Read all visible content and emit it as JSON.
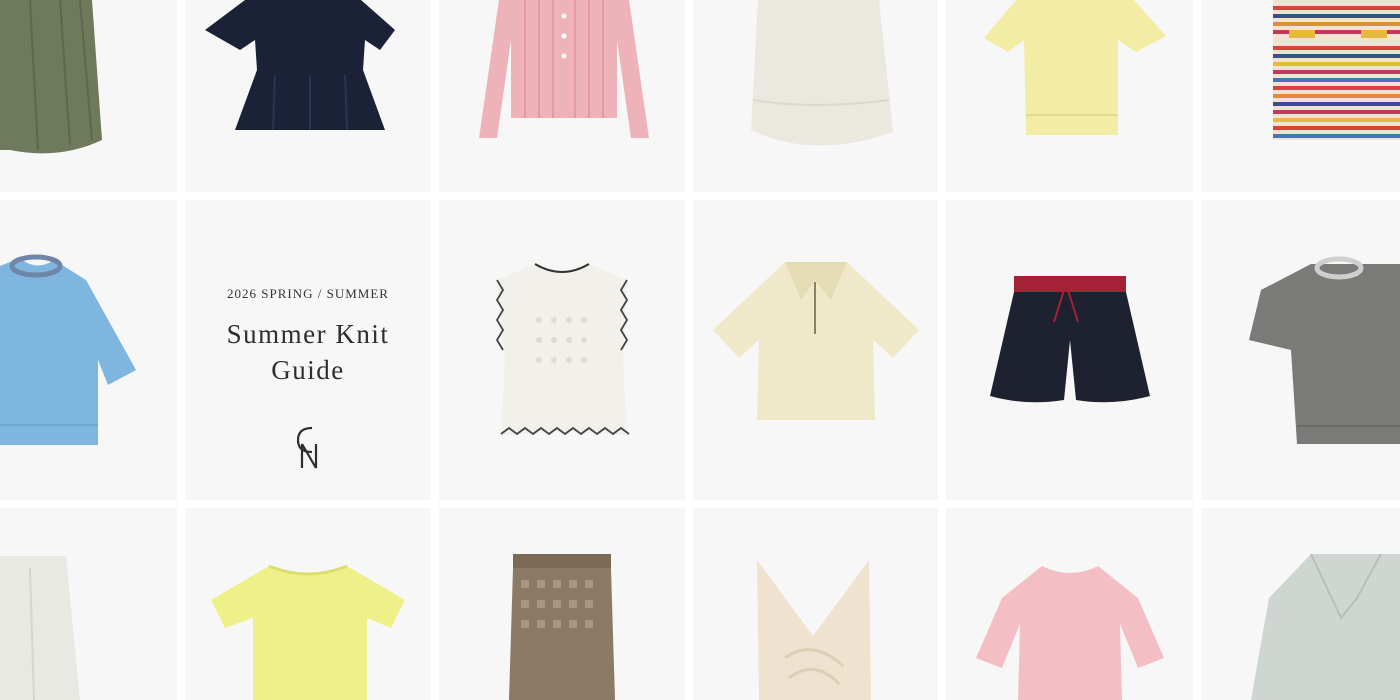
{
  "banner": {
    "season": "2026 SPRING / SUMMER",
    "title_line1": "Summer Knit",
    "title_line2": "Guide",
    "logo_text": "CN",
    "background": "#f7f7f8",
    "divider": "#ffffff"
  },
  "products": [
    {
      "id": "olive-skirt",
      "icon": "olive-knit-skirt",
      "color": "#6f7a5c"
    },
    {
      "id": "navy-peplum",
      "icon": "navy-peplum-top",
      "color": "#1b2238"
    },
    {
      "id": "pink-cardigan",
      "icon": "pink-rib-cardigan",
      "color": "#eeb3b9"
    },
    {
      "id": "ivory-top",
      "icon": "ivory-knit-top",
      "color": "#ebe8df"
    },
    {
      "id": "yellow-tee",
      "icon": "yellow-knit-tee",
      "color": "#f3eca4"
    },
    {
      "id": "stripe-knit",
      "icon": "multi-stripe-knit",
      "color": "#d9443a"
    },
    {
      "id": "blue-tee",
      "icon": "blue-sheer-knit",
      "color": "#7fb6e0"
    },
    {
      "id": "white-vest",
      "icon": "white-crochet-vest",
      "color": "#f2f0ea"
    },
    {
      "id": "cream-polo",
      "icon": "cream-zip-polo",
      "color": "#efe9c9"
    },
    {
      "id": "navy-shorts",
      "icon": "navy-knit-shorts",
      "color": "#1e2230"
    },
    {
      "id": "grey-tee",
      "icon": "grey-knit-tee",
      "color": "#7a7a79"
    },
    {
      "id": "white-pants",
      "icon": "white-knit-pants",
      "color": "#e9e9e4"
    },
    {
      "id": "lime-tee",
      "icon": "lime-knit-tee",
      "color": "#eef08a"
    },
    {
      "id": "mesh-skirt",
      "icon": "taupe-mesh-skirt",
      "color": "#8c7a66"
    },
    {
      "id": "twist-top",
      "icon": "beige-twist-top",
      "color": "#efe3cf"
    },
    {
      "id": "pink-sweater",
      "icon": "pink-knit-sweater",
      "color": "#f4bfc4"
    },
    {
      "id": "sage-jacket",
      "icon": "sage-knit-jacket",
      "color": "#cfd5d0"
    }
  ]
}
